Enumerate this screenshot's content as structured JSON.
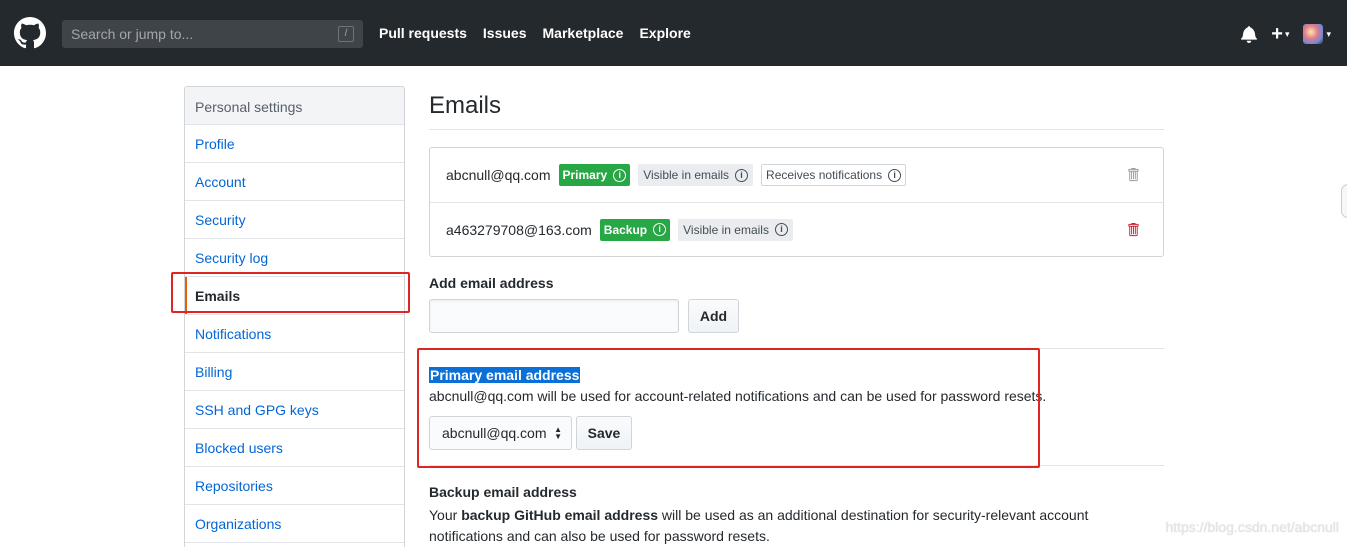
{
  "header": {
    "search_placeholder": "Search or jump to...",
    "search_shortcut": "/",
    "nav": [
      "Pull requests",
      "Issues",
      "Marketplace",
      "Explore"
    ],
    "plus_label": "+",
    "caret": "▾"
  },
  "sidebar": {
    "heading": "Personal settings",
    "items": [
      {
        "label": "Profile"
      },
      {
        "label": "Account"
      },
      {
        "label": "Security"
      },
      {
        "label": "Security log"
      },
      {
        "label": "Emails",
        "selected": true
      },
      {
        "label": "Notifications"
      },
      {
        "label": "Billing"
      },
      {
        "label": "SSH and GPG keys"
      },
      {
        "label": "Blocked users"
      },
      {
        "label": "Repositories"
      },
      {
        "label": "Organizations"
      }
    ]
  },
  "main": {
    "title": "Emails",
    "emails": [
      {
        "address": "abcnull@qq.com",
        "badge": "Primary",
        "visible": "Visible in emails",
        "notif": "Receives notifications"
      },
      {
        "address": "a463279708@163.com",
        "badge": "Backup",
        "visible": "Visible in emails"
      }
    ],
    "add": {
      "label": "Add email address",
      "button": "Add"
    },
    "primary": {
      "label": "Primary email address",
      "desc": "abcnull@qq.com will be used for account-related notifications and can be used for password resets.",
      "selected": "abcnull@qq.com",
      "save": "Save"
    },
    "backup": {
      "label": "Backup email address",
      "desc_pre": "Your ",
      "desc_bold": "backup GitHub email address",
      "desc_post": " will be used as an additional destination for security-relevant account notifications and can also be used for password resets."
    }
  },
  "watermark": "https://blog.csdn.net/abcnull",
  "colors": {
    "header_bg": "#24292e",
    "link": "#0366d6",
    "green": "#28a745",
    "annotation_red": "#e02424",
    "selected_bar": "#e36209"
  }
}
